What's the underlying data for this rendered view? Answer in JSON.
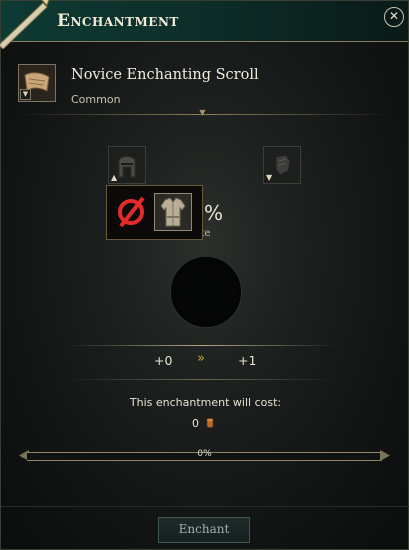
{
  "window": {
    "title": "Enchantment",
    "close_icon": "close-icon"
  },
  "item": {
    "name": "Novice Enchanting Scroll",
    "rarity": "Common",
    "icon": "scroll-icon"
  },
  "slots": {
    "left_icon": "helmet-icon",
    "right_icon": "gauntlet-icon"
  },
  "success": {
    "percent_symbol": "%",
    "rate_partial": "ss Rate"
  },
  "popup": {
    "none_icon": "no-item-icon",
    "armor_icon": "armor-icon"
  },
  "levels": {
    "from": "+0",
    "arrow": "»",
    "to": "+1"
  },
  "cost": {
    "label": "This enchantment will cost:",
    "value": "0",
    "icon": "coin-icon"
  },
  "progress": {
    "value": 0,
    "label": "0%"
  },
  "actions": {
    "enchant_label": "Enchant"
  },
  "colors": {
    "header": "#0d3a33",
    "accent_gold": "#c7a34a",
    "red_none": "#e52a2a"
  }
}
